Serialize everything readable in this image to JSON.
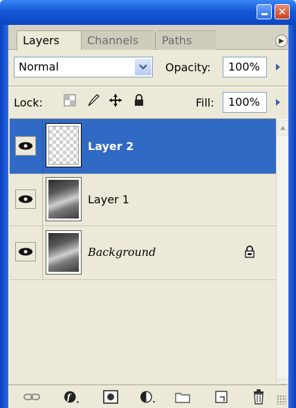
{
  "window": {
    "minimize_icon": "minimize-icon",
    "close_icon": "close-icon",
    "accent": "#0b46c2"
  },
  "tabs": [
    {
      "label": "Layers",
      "active": true
    },
    {
      "label": "Channels",
      "active": false
    },
    {
      "label": "Paths",
      "active": false
    }
  ],
  "blend": {
    "mode": "Normal",
    "opacity_label": "Opacity:",
    "opacity_value": "100%"
  },
  "lock": {
    "label": "Lock:",
    "icons": [
      "lock-transparent-pixels-icon",
      "lock-image-pixels-icon",
      "lock-position-icon",
      "lock-all-icon"
    ],
    "fill_label": "Fill:",
    "fill_value": "100%"
  },
  "layers": [
    {
      "name": "Layer 2",
      "selected": true,
      "visible": true,
      "thumbnail": "transparent",
      "locked": false
    },
    {
      "name": "Layer 1",
      "selected": false,
      "visible": true,
      "thumbnail": "photo",
      "locked": false
    },
    {
      "name": "Background",
      "selected": false,
      "visible": true,
      "thumbnail": "photo",
      "locked": true
    }
  ],
  "toolbar": {
    "icons": [
      "link-layers-icon",
      "layer-style-icon",
      "add-mask-icon",
      "adjustment-layer-icon",
      "new-group-icon",
      "new-layer-icon",
      "delete-layer-icon"
    ]
  },
  "colors": {
    "panel_bg": "#ece9d8",
    "selection": "#316ac5"
  }
}
